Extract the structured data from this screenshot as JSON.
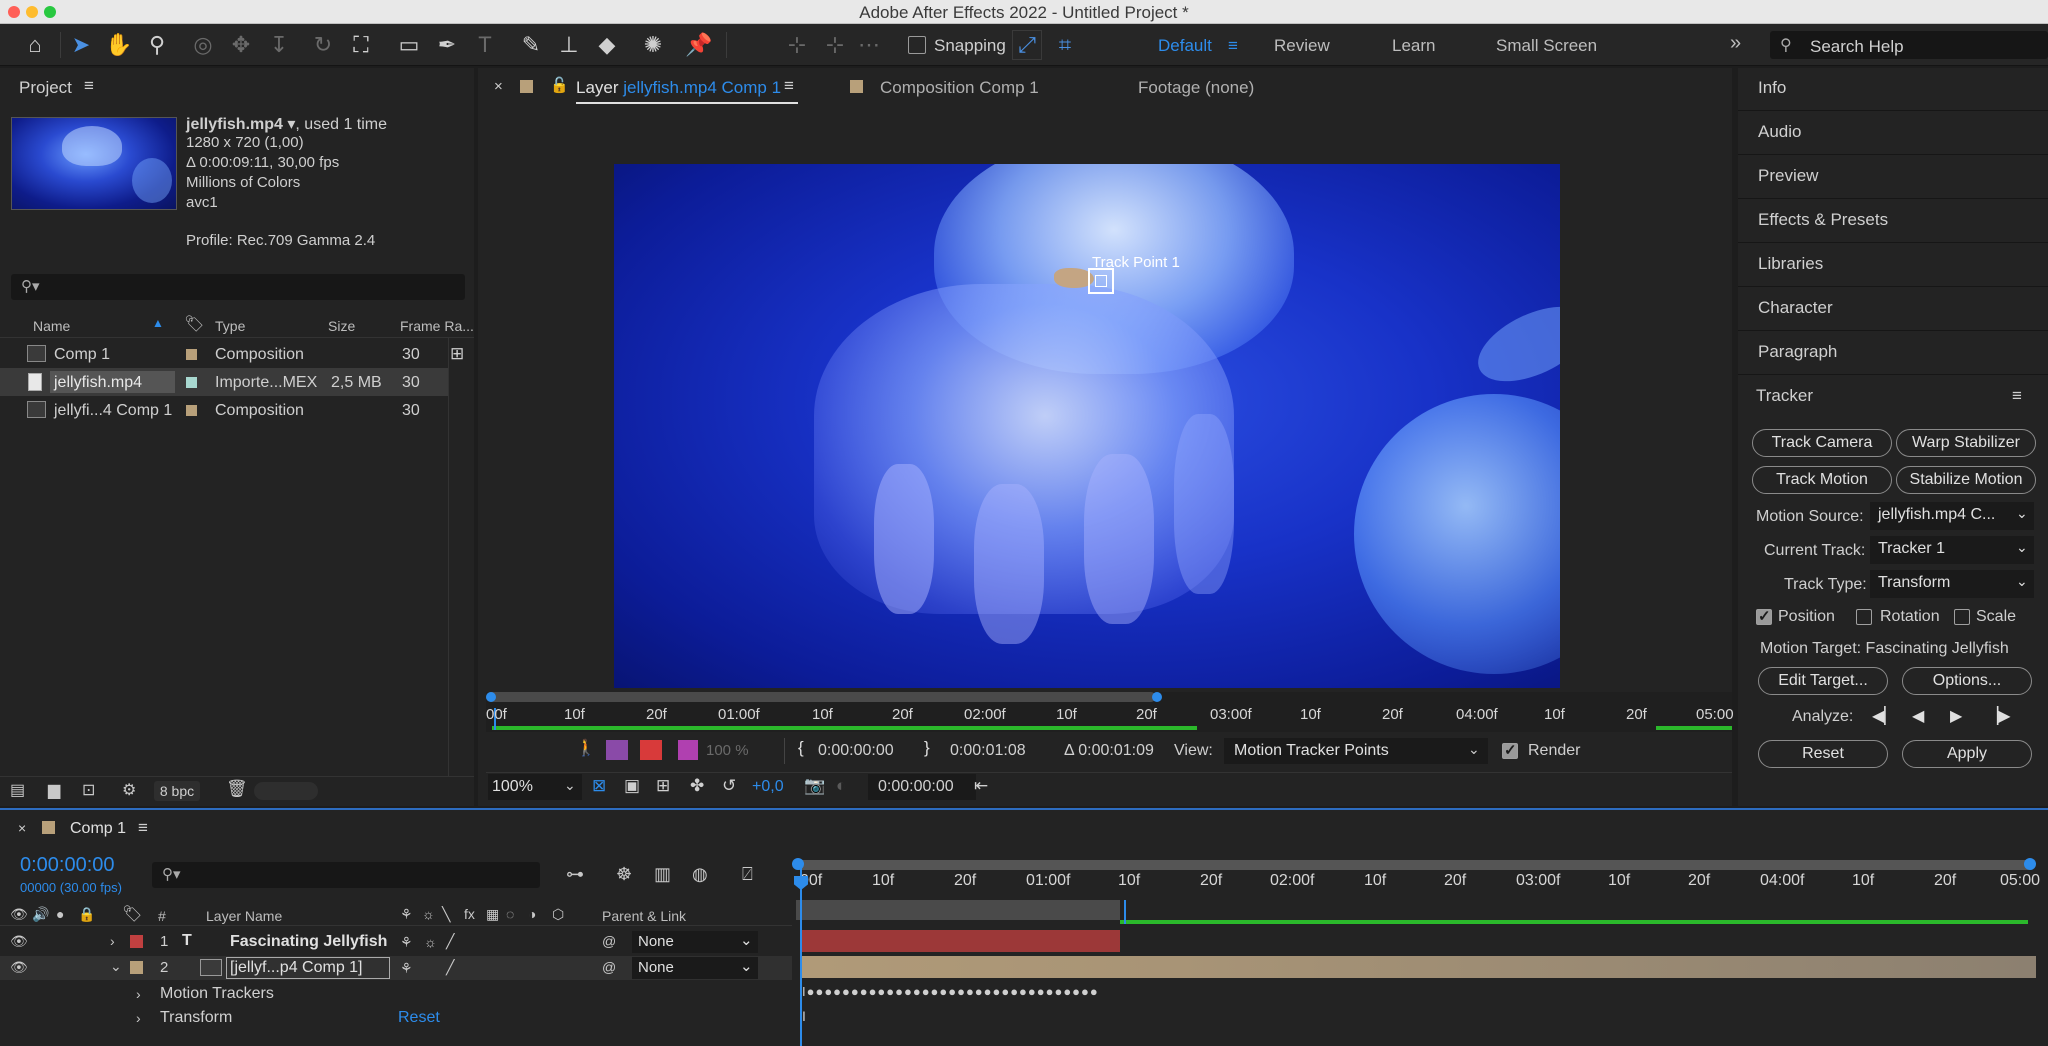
{
  "window": {
    "title": "Adobe After Effects 2022 - Untitled Project *"
  },
  "toolbar": {
    "tools": [
      "home-icon",
      "selection-tool-icon",
      "hand-tool-icon",
      "zoom-tool-icon",
      "orbit-icon",
      "pan-icon",
      "dolly-icon",
      "rotate-icon",
      "pan-behind-icon",
      "rectangle-tool-icon",
      "pen-tool-icon",
      "type-tool-icon",
      "brush-tool-icon",
      "clone-stamp-icon",
      "eraser-icon",
      "roto-brush-icon",
      "puppet-pin-icon"
    ],
    "snapping_label": "Snapping",
    "workspaces": [
      "Default",
      "Review",
      "Learn",
      "Small Screen"
    ],
    "active_workspace": "Default",
    "search_placeholder": "Search Help"
  },
  "project": {
    "title": "Project",
    "file_name": "jellyfish.mp4",
    "used": ", used 1 time",
    "resolution": "1280 x 720 (1,00)",
    "duration": "Δ 0:00:09:11, 30,00 fps",
    "colors": "Millions of Colors",
    "codec": "avc1",
    "profile": "Profile: Rec.709 Gamma 2.4",
    "columns": {
      "name": "Name",
      "type": "Type",
      "size": "Size",
      "frame_rate": "Frame Ra..."
    },
    "items": [
      {
        "name": "Comp 1",
        "type": "Composition",
        "size": "",
        "fps": "30",
        "color": "#b8a07a"
      },
      {
        "name": "jellyfish.mp4",
        "type": "Importe...MEX",
        "size": "2,5 MB",
        "fps": "30",
        "color": "#a8d8d0"
      },
      {
        "name": "jellyfi...4 Comp 1",
        "type": "Composition",
        "size": "",
        "fps": "30",
        "color": "#b8a07a"
      }
    ],
    "bpc": "8 bpc"
  },
  "viewer": {
    "tabs": {
      "layer_prefix": "Layer",
      "layer_name": "jellyfish.mp4 Comp 1",
      "composition": "Composition Comp 1",
      "footage": "Footage (none)"
    },
    "track_point_label": "Track Point 1",
    "ruler_labels": [
      "00f",
      "10f",
      "20f",
      "01:00f",
      "10f",
      "20f",
      "02:00f",
      "10f",
      "20f",
      "03:00f",
      "10f",
      "20f",
      "04:00f",
      "10f",
      "20f",
      "05:00"
    ],
    "in_time": "0:00:00:00",
    "out_time": "0:00:01:08",
    "duration": "Δ 0:00:01:09",
    "view_label": "View:",
    "view_value": "Motion Tracker Points",
    "render_label": "Render",
    "zoom": "100%",
    "exposure": "+0,0",
    "current_time": "0:00:00:00",
    "opacity": "100 %"
  },
  "right_panel": {
    "items": [
      "Info",
      "Audio",
      "Preview",
      "Effects & Presets",
      "Libraries",
      "Character",
      "Paragraph"
    ],
    "tracker": {
      "title": "Tracker",
      "buttons": {
        "track_camera": "Track Camera",
        "warp_stabilizer": "Warp Stabilizer",
        "track_motion": "Track Motion",
        "stabilize_motion": "Stabilize Motion"
      },
      "motion_source_label": "Motion Source:",
      "motion_source_value": "jellyfish.mp4 C...",
      "current_track_label": "Current Track:",
      "current_track_value": "Tracker 1",
      "track_type_label": "Track Type:",
      "track_type_value": "Transform",
      "position_label": "Position",
      "rotation_label": "Rotation",
      "scale_label": "Scale",
      "position_checked": true,
      "rotation_checked": false,
      "scale_checked": false,
      "motion_target": "Motion Target: Fascinating Jellyfish",
      "edit_target": "Edit Target...",
      "options": "Options...",
      "analyze_label": "Analyze:",
      "reset": "Reset",
      "apply": "Apply"
    }
  },
  "timeline": {
    "tab": "Comp 1",
    "timecode": "0:00:00:00",
    "frame_info": "00000 (30.00 fps)",
    "ruler_labels": [
      "00f",
      "10f",
      "20f",
      "01:00f",
      "10f",
      "20f",
      "02:00f",
      "10f",
      "20f",
      "03:00f",
      "10f",
      "20f",
      "04:00f",
      "10f",
      "20f",
      "05:00"
    ],
    "columns": {
      "number": "#",
      "layer_name": "Layer Name",
      "parent": "Parent & Link"
    },
    "layers": [
      {
        "number": "1",
        "name": "Fascinating Jellyfish",
        "parent": "None",
        "color": "#c04040",
        "type_icon": "T"
      },
      {
        "number": "2",
        "name": "[jellyf...p4 Comp 1]",
        "parent": "None",
        "color": "#b8a07a"
      }
    ],
    "sub_rows": {
      "motion_trackers": "Motion Trackers",
      "transform": "Transform",
      "reset": "Reset"
    }
  }
}
